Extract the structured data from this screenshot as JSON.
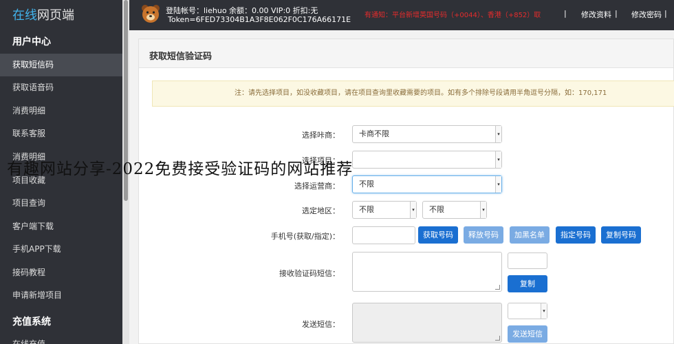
{
  "sidebar": {
    "logo_brand": "在线",
    "logo_rest": "网页端",
    "section_user": "用户中心",
    "items": [
      {
        "label": "获取短信码"
      },
      {
        "label": "获取语音码"
      },
      {
        "label": "消费明细"
      },
      {
        "label": "联系客服"
      },
      {
        "label": "消费明细"
      },
      {
        "label": "项目收藏"
      },
      {
        "label": "项目查询"
      },
      {
        "label": "客户端下载"
      },
      {
        "label": "手机APP下载"
      },
      {
        "label": "接码教程"
      },
      {
        "label": "申请新增项目"
      }
    ],
    "section_recharge": "充值系统",
    "recharge_item": "在线充值"
  },
  "topbar": {
    "account_line": "登陆帐号：liehuo 余额：0.00  VIP:0 折扣:无",
    "token_line": "Token=6FED73304B1A3F8E062F0C176A66171E",
    "notice": "有通知：平台新增英国号码（+0044）、香港（+852）取",
    "edit_profile": "修改资料",
    "change_password": "修改密码",
    "separator": "|"
  },
  "page": {
    "card_title": "获取短信验证码",
    "alert": "注：请先选择项目，如没收藏项目，请在项目查询里收藏需要的项目。如有多个排除号段请用半角逗号分隔，如：170,171"
  },
  "form": {
    "card_label": "选择咔商：",
    "card_value": "卡商不限",
    "project_label": "选择项目：",
    "project_value": "",
    "carrier_label": "选择运营商：",
    "carrier_value": "不限",
    "region_label": "选定地区：",
    "region_value_1": "不限",
    "region_value_2": "不限",
    "phone_label": "手机号(获取/指定)：",
    "phone_value": "",
    "receive_label": "接收验证码短信：",
    "send_label": "发送短信："
  },
  "buttons": {
    "get_number": "获取号码",
    "release_number": "释放号码",
    "blacklist": "加黑名单",
    "assign_number": "指定号码",
    "copy_number": "复制号码",
    "copy": "复制",
    "send_sms": "发送短信"
  },
  "overlay": {
    "text": "有趣网站分享-2022免费接受验证码的网站推荐"
  },
  "colors": {
    "sidebar_bg": "#2f3137",
    "accent_blue": "#1a6fd1",
    "notice_red": "#e62c2c",
    "alert_bg": "#fcf8e3",
    "logo_blue": "#42b4ec"
  }
}
